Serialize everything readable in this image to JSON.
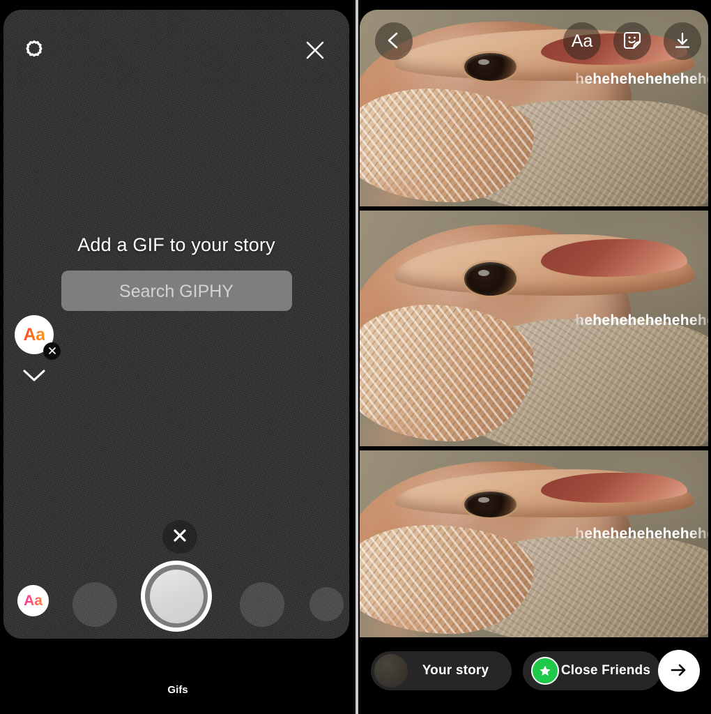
{
  "left_panel": {
    "name": "gif-picker-camera",
    "top_bar": {
      "settings_icon": "gear-icon",
      "close_icon": "close-icon"
    },
    "prompt": {
      "title": "Add a GIF to your story",
      "search_button_label": "Search GIPHY",
      "search_placeholder": "Search GIPHY"
    },
    "sticker": {
      "label": "Aa",
      "delete_icon": "close-icon",
      "collapse_icon": "chevron-down-icon"
    },
    "camera_controls": {
      "close_icon": "close-icon",
      "text_tool_label": "Aa",
      "shutter_icon": "shutter-button"
    },
    "footer_label": "Gifs"
  },
  "right_panel": {
    "name": "story-preview",
    "toolbar": {
      "back_icon": "chevron-left-icon",
      "text_label": "Aa",
      "sticker_icon": "sticker-smiley-icon",
      "save_icon": "download-icon"
    },
    "tiles": [
      {
        "overlay_text": "hehehehehehehehe",
        "alt": "bearded-dragon-lizard-photo"
      },
      {
        "overlay_text": "hehehehehehehehe",
        "alt": "bearded-dragon-lizard-photo"
      },
      {
        "overlay_text": "hehehehehehehehe",
        "alt": "bearded-dragon-lizard-photo"
      }
    ],
    "action_bar": {
      "your_story_label": "Your story",
      "close_friends_label": "Close Friends",
      "close_friends_badge_icon": "star-icon",
      "send_icon": "arrow-right-icon"
    }
  },
  "colors": {
    "close_friends_green": "#1ec94a",
    "pill_background": "#262626",
    "accent_white": "#ffffff",
    "camera_background": "#262626"
  }
}
